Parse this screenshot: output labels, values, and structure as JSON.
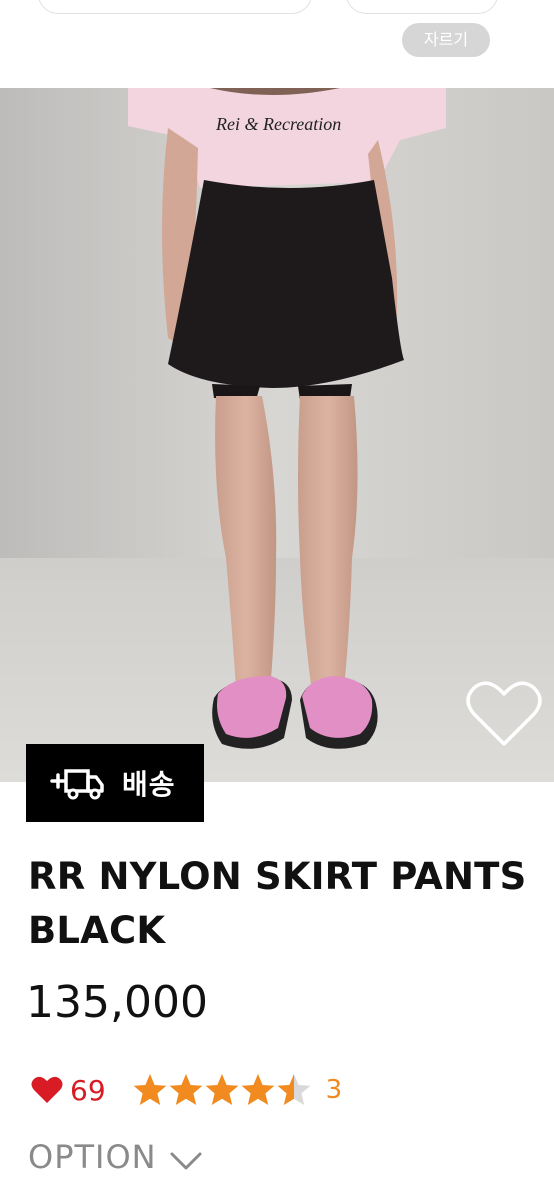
{
  "header": {
    "crop_label": "자르기"
  },
  "image": {
    "shirt_print_text": "Rei & Recreation"
  },
  "badges": {
    "delivery_label": "배송",
    "delivery_icon": "delivery-truck-icon"
  },
  "product": {
    "name": "RR NYLON SKIRT PANTS BLACK",
    "price": "135,000",
    "likes": "69",
    "rating": 4.5,
    "review_count": "3",
    "option_label": "OPTION"
  },
  "colors": {
    "like_red": "#d81b24",
    "star_orange": "#f18a1f",
    "star_empty": "#d9d9d9",
    "muted_gray": "#8a8a8a"
  },
  "icons": [
    "wishlist-heart-icon",
    "delivery-truck-icon",
    "like-heart-icon",
    "star-icon",
    "chevron-down-icon"
  ]
}
